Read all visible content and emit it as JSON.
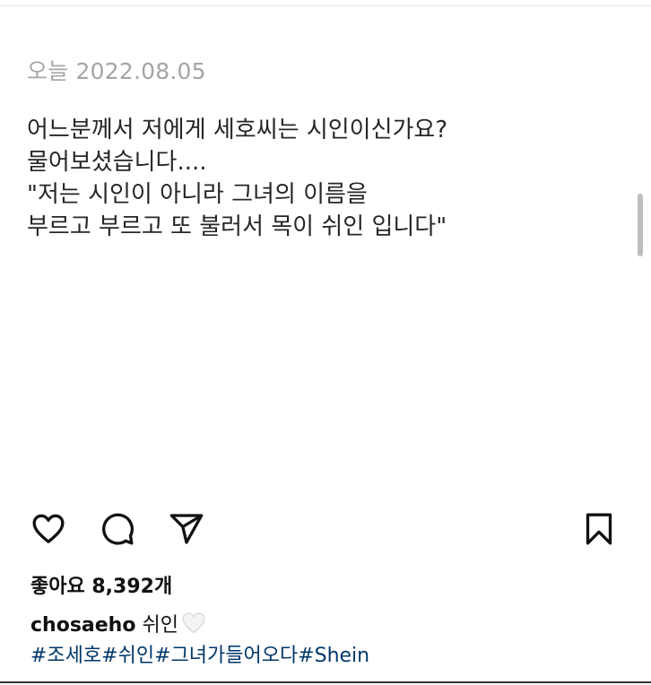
{
  "post": {
    "date": "오늘 2022.08.05",
    "lines": [
      "어느분께서 저에게 세호씨는 시인이신가요?",
      "물어보셨습니다....",
      "\"저는 시인이 아니라 그녀의 이름을",
      "부르고 부르고 또 불러서 목이 쉬인 입니다\""
    ]
  },
  "actions": {
    "icons": [
      "heart-icon",
      "comment-icon",
      "send-icon",
      "bookmark-icon"
    ]
  },
  "likes": {
    "text": "좋아요 8,392개"
  },
  "caption": {
    "username": "chosaeho",
    "text": "쉬인",
    "emoji_icon": "white-heart-icon"
  },
  "hashtags": {
    "text": "#조세호#쉬인#그녀가들어오다#Shein"
  },
  "colors": {
    "hashtag": "#00376b",
    "date": "#a5a5a5",
    "text": "#262626"
  }
}
